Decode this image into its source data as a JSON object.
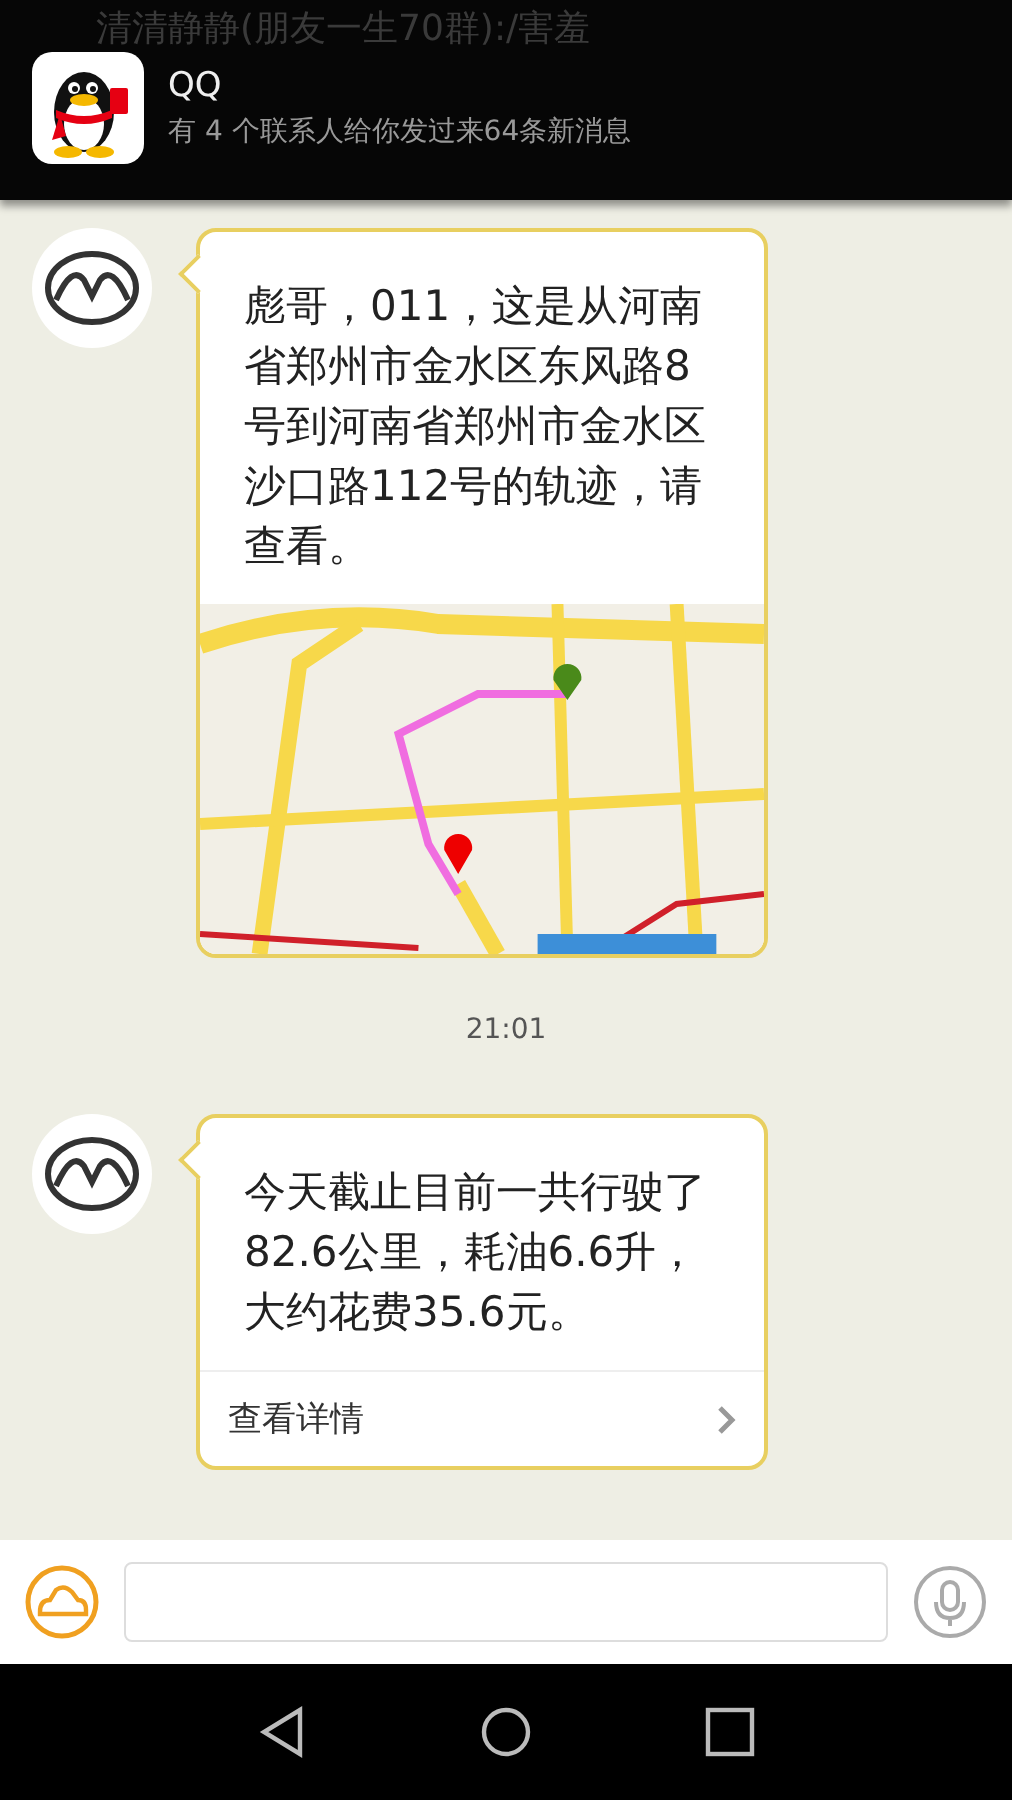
{
  "header": {
    "title": "清清静静(朋友一生70群):/害羞"
  },
  "notification": {
    "app": "QQ",
    "message": "有 4 个联系人给你发过来64条新消息"
  },
  "messages": [
    {
      "kind": "map",
      "text": "彪哥，011，这是从河南省郑州市金水区东风路8号到河南省郑州市金水区沙口路112号的轨迹，请查看。"
    },
    {
      "kind": "time",
      "text": "21:01"
    },
    {
      "kind": "summary",
      "text": "今天截止目前一共行驶了82.6公里，耗油6.6升，大约花费35.6元。",
      "link": "查看详情"
    }
  ]
}
